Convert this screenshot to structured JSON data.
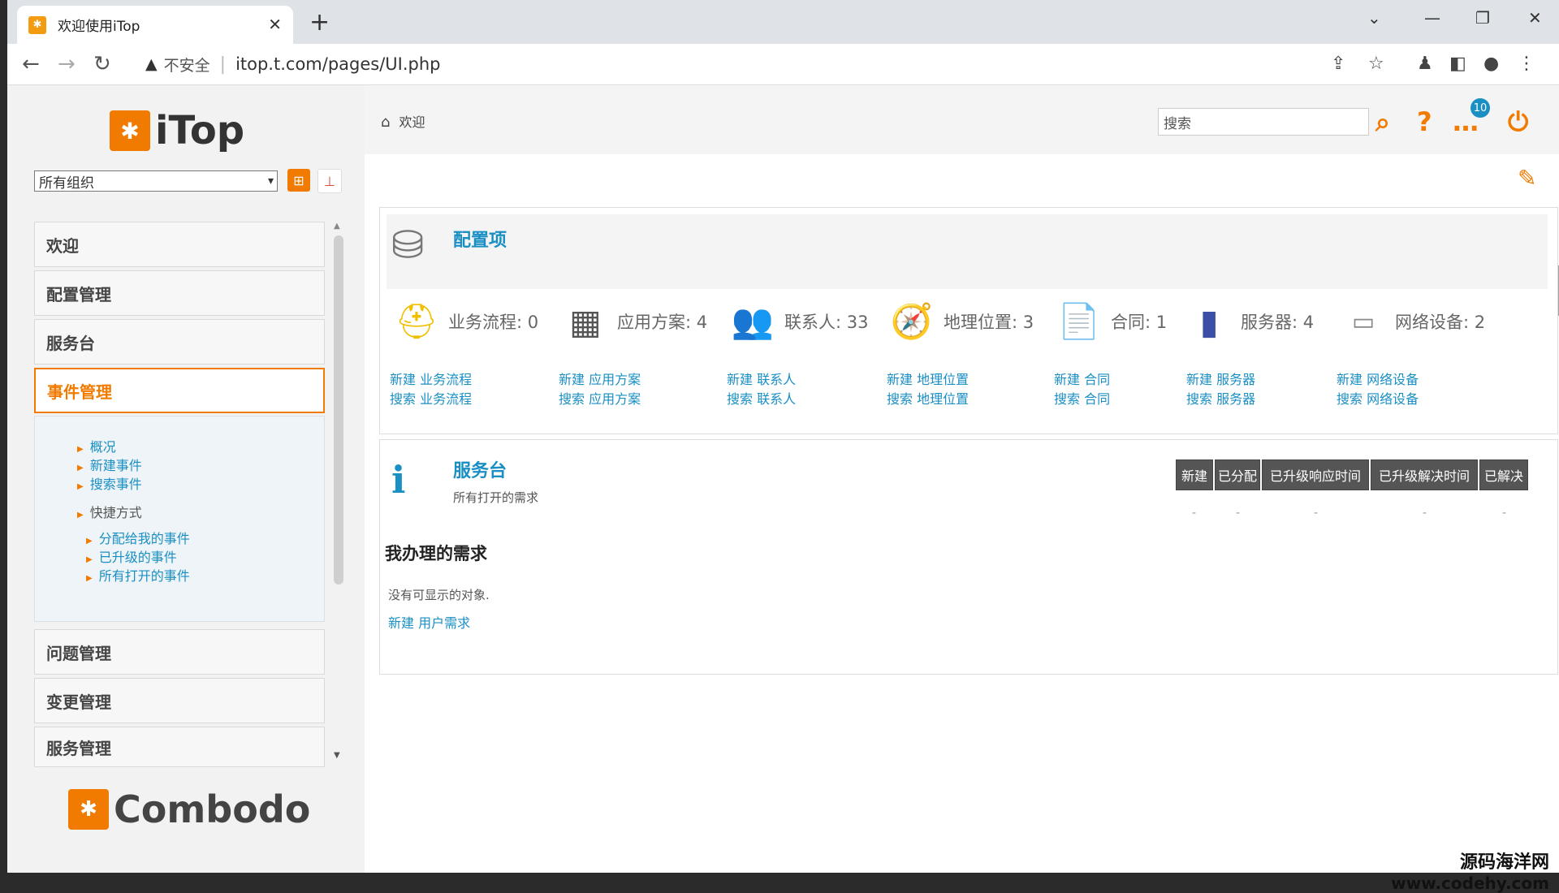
{
  "browser": {
    "tab_title": "欢迎使用iTop",
    "insecure_label": "不安全",
    "url": "itop.t.com/pages/UI.php"
  },
  "sidebar": {
    "logo_text": "iTop",
    "org_select": "所有组织",
    "menu": {
      "welcome": "欢迎",
      "config_mgmt": "配置管理",
      "service_desk": "服务台",
      "incident_mgmt": "事件管理",
      "problem_mgmt": "问题管理",
      "change_mgmt": "变更管理",
      "service_mgmt": "服务管理"
    },
    "submenu": {
      "overview": "概况",
      "new_incident": "新建事件",
      "search_incident": "搜索事件",
      "shortcuts": "快捷方式",
      "assigned_to_me": "分配给我的事件",
      "escalated": "已升级的事件",
      "all_open": "所有打开的事件"
    },
    "footer_logo": "Combodo"
  },
  "header": {
    "breadcrumb": "欢迎",
    "search_placeholder": "搜索",
    "notification_count": "10"
  },
  "config_panel": {
    "title": "配置项",
    "items": [
      {
        "label": "业务流程: 0",
        "new": "新建 业务流程",
        "search": "搜索 业务流程"
      },
      {
        "label": "应用方案: 4",
        "new": "新建 应用方案",
        "search": "搜索 应用方案"
      },
      {
        "label": "联系人: 33",
        "new": "新建 联系人",
        "search": "搜索 联系人"
      },
      {
        "label": "地理位置: 3",
        "new": "新建 地理位置",
        "search": "搜索 地理位置"
      },
      {
        "label": "合同: 1",
        "new": "新建 合同",
        "search": "搜索 合同"
      },
      {
        "label": "服务器: 4",
        "new": "新建 服务器",
        "search": "搜索 服务器"
      },
      {
        "label": "网络设备: 2",
        "new": "新建 网络设备",
        "search": "搜索 网络设备"
      }
    ]
  },
  "service_panel": {
    "title": "服务台",
    "subtitle": "所有打开的需求",
    "columns": [
      "新建",
      "已分配",
      "已升级响应时间",
      "已升级解决时间",
      "已解决"
    ],
    "dash": "-",
    "my_requests_title": "我办理的需求",
    "empty_text": "没有可显示的对象.",
    "new_request_link": "新建 用户需求"
  },
  "watermark": {
    "line1": "源码海洋网",
    "line2": "www.codehy.com"
  }
}
